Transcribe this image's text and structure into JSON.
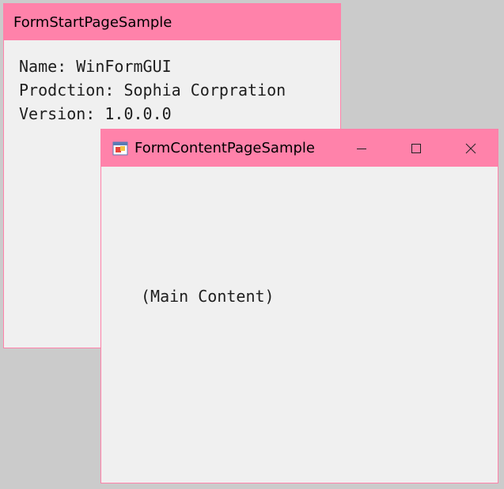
{
  "start_window": {
    "title": "FormStartPageSample",
    "lines": {
      "name": "Name: WinFormGUI",
      "production": "Prodction: Sophia Corpration",
      "version": "Version: 1.0.0.0"
    }
  },
  "content_window": {
    "title": "FormContentPageSample",
    "icon": "winforms-app-icon",
    "buttons": [
      "minimize-icon",
      "maximize-icon",
      "close-icon"
    ],
    "main_text": "(Main Content)"
  },
  "colors": {
    "titlebar": "#ff82aa",
    "window_bg": "#f0f0f0",
    "desktop_bg": "#cbcbcb"
  }
}
